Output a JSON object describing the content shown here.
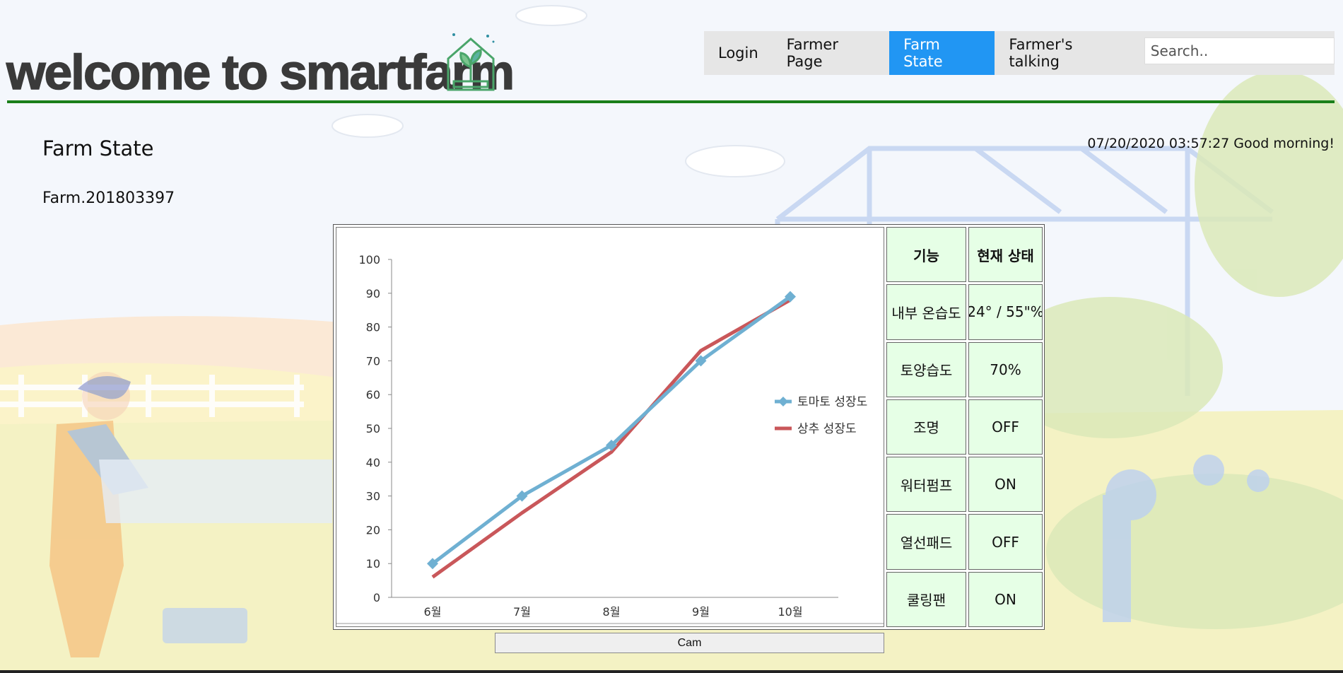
{
  "header": {
    "brand": "welcome to smartfarm",
    "nav": [
      {
        "label": "Login",
        "active": false
      },
      {
        "label": "Farmer Page",
        "active": false
      },
      {
        "label": "Farm State",
        "active": true
      },
      {
        "label": "Farmer's talking",
        "active": false
      }
    ],
    "search": {
      "placeholder": "Search.."
    },
    "logo_icon": "greenhouse-plant-icon"
  },
  "page": {
    "title": "Farm State",
    "farm_id": "Farm.201803397",
    "datetime": "07/20/2020 03:57:27",
    "greeting": "Good morning!"
  },
  "status_table": {
    "headers": [
      "기능",
      "현재 상태"
    ],
    "rows": [
      [
        "내부 온습도",
        "24° / 55\"%"
      ],
      [
        "토양습도",
        "70%"
      ],
      [
        "조명",
        "OFF"
      ],
      [
        "워터펌프",
        "ON"
      ],
      [
        "열선패드",
        "OFF"
      ],
      [
        "쿨링팬",
        "ON"
      ]
    ]
  },
  "cam_button": {
    "label": "Cam"
  },
  "colors": {
    "accent": "#2196f3",
    "header_rule": "#1a7f1a",
    "table_cell": "#e6ffe6",
    "tomato_series": "#6fb0d2",
    "lettuce_series": "#c9575a"
  },
  "chart_data": {
    "type": "line",
    "categories": [
      "6월",
      "7월",
      "8월",
      "9월",
      "10월"
    ],
    "ylim": [
      0,
      100
    ],
    "yticks": [
      0,
      10,
      20,
      30,
      40,
      50,
      60,
      70,
      80,
      90,
      100
    ],
    "legend_position": "right",
    "grid": false,
    "series": [
      {
        "name": "토마토 성장도",
        "values": [
          10,
          30,
          45,
          70,
          89
        ],
        "marker": "diamond"
      },
      {
        "name": "상추 성장도",
        "values": [
          6,
          25,
          43,
          73,
          88
        ],
        "marker": "none"
      }
    ]
  }
}
